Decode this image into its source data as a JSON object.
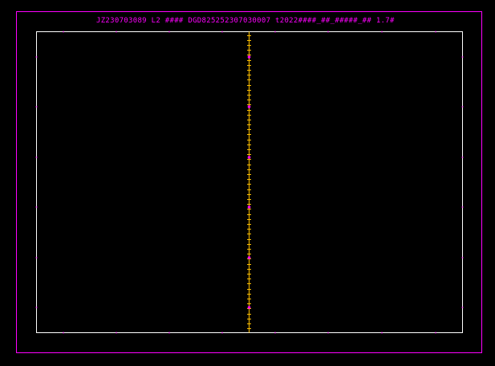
{
  "viewer": {
    "title": "JZ230703089  L2  ####  DGD8252523070300​07 t2022####_##_#####_## 1.7#"
  },
  "colors": {
    "background": "#000000",
    "frame": "#ff00ff",
    "plot_border": "#ffffff",
    "trace": "#ffc000",
    "markers": "#ff00ff"
  }
}
